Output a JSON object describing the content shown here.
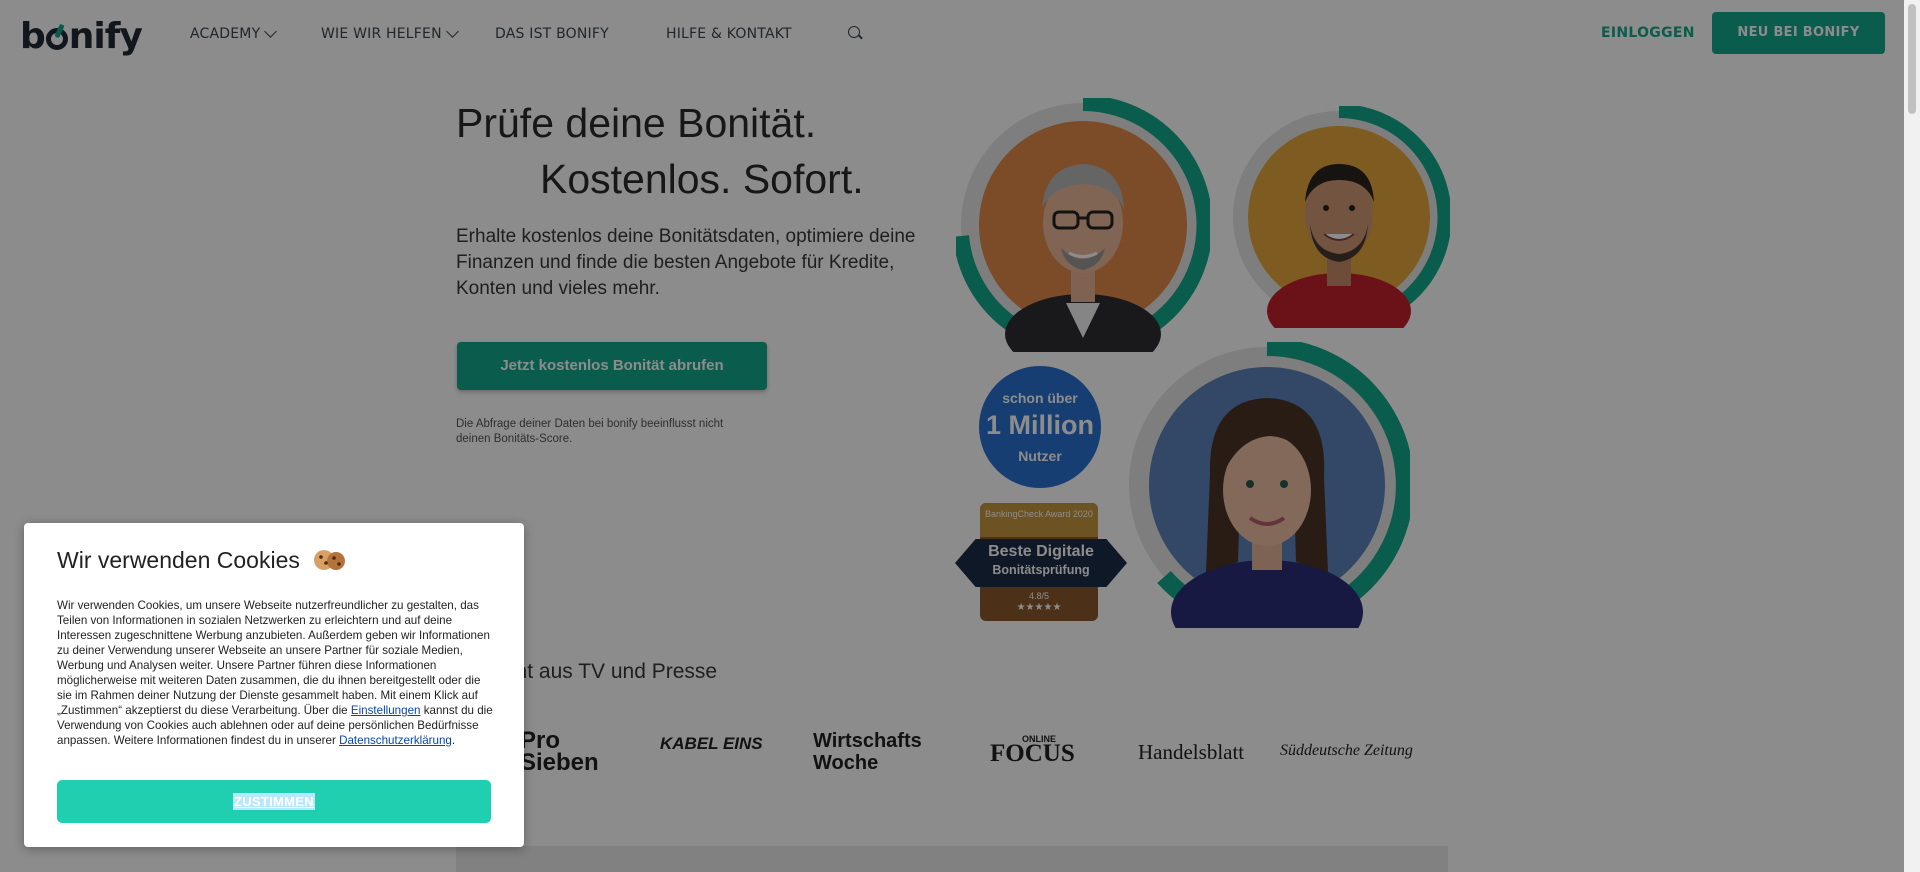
{
  "nav": {
    "logo": "bonify",
    "items": [
      {
        "label": "ACADEMY",
        "dropdown": true
      },
      {
        "label": "WIE WIR HELFEN",
        "dropdown": true
      },
      {
        "label": "DAS IST BONIFY",
        "dropdown": false
      },
      {
        "label": "HILFE & KONTAKT",
        "dropdown": false
      }
    ],
    "search_icon": "search-icon",
    "login": "EINLOGGEN",
    "signup": "NEU BEI BONIFY"
  },
  "hero": {
    "headline_1": "Prüfe deine Bonität.",
    "headline_2": "Kostenlos. Sofort.",
    "lead": "Erhalte kostenlos deine Bonitätsdaten, optimiere deine Finanzen und finde die besten Angebote für Kredite, Konten und vieles mehr.",
    "cta": "Jetzt kostenlos Bonität abrufen",
    "disclaimer": "Die Abfrage deiner Daten bei bonify beeinflusst nicht deinen Bonitäts-Score."
  },
  "badges": {
    "users_top": "schon über",
    "users_main": "1 Million",
    "users_bottom": "Nutzer",
    "award_top": "BankingCheck Award 2020",
    "award_main": "Beste Digitale",
    "award_sub": "Bonitätsprüfung",
    "award_rating": "4.8/5",
    "award_stars": "★★★★★"
  },
  "press": {
    "title": "Bekannt aus TV und Presse",
    "logos": [
      "Pro Sieben",
      "KABEL EINS",
      "Wirtschafts Woche",
      "FOCUS",
      "Handelsblatt",
      "Süddeutsche Zeitung"
    ],
    "focus_small": "ONLINE"
  },
  "cookie": {
    "title": "Wir verwenden Cookies",
    "icon": "cookie-icon",
    "text_1": "Wir verwenden Cookies, um unsere Webseite nutzerfreundlicher zu gestalten, das Teilen von Informationen in sozialen Netzwerken zu erleichtern und auf deine Interessen zugeschnittene Werbung anzubieten. Außerdem geben wir Informationen zu deiner Verwendung unserer Webseite an unsere Partner für soziale Medien, Werbung und Analysen weiter. Unsere Partner führen diese Informationen möglicherweise mit weiteren Daten zusammen, die du ihnen bereitgestellt oder die sie im Rahmen deiner Nutzung der Dienste gesammelt haben. Mit einem Klick auf „Zustimmen“ akzeptierst du diese Verarbeitung. Über die ",
    "settings_link": "Einstellungen",
    "text_2": " kannst du die Verwendung von Cookies auch ablehnen oder auf deine persönlichen Bedürfnisse anpassen. Weitere Informationen findest du in unserer ",
    "privacy_link": "Datenschutzerklärung",
    "text_3": ".",
    "agree": "ZUSTIMMEN"
  },
  "colors": {
    "brand": "#13a88a",
    "agree_button": "#1fcfb0",
    "overlay": "rgba(0,0,0,0.45)"
  }
}
